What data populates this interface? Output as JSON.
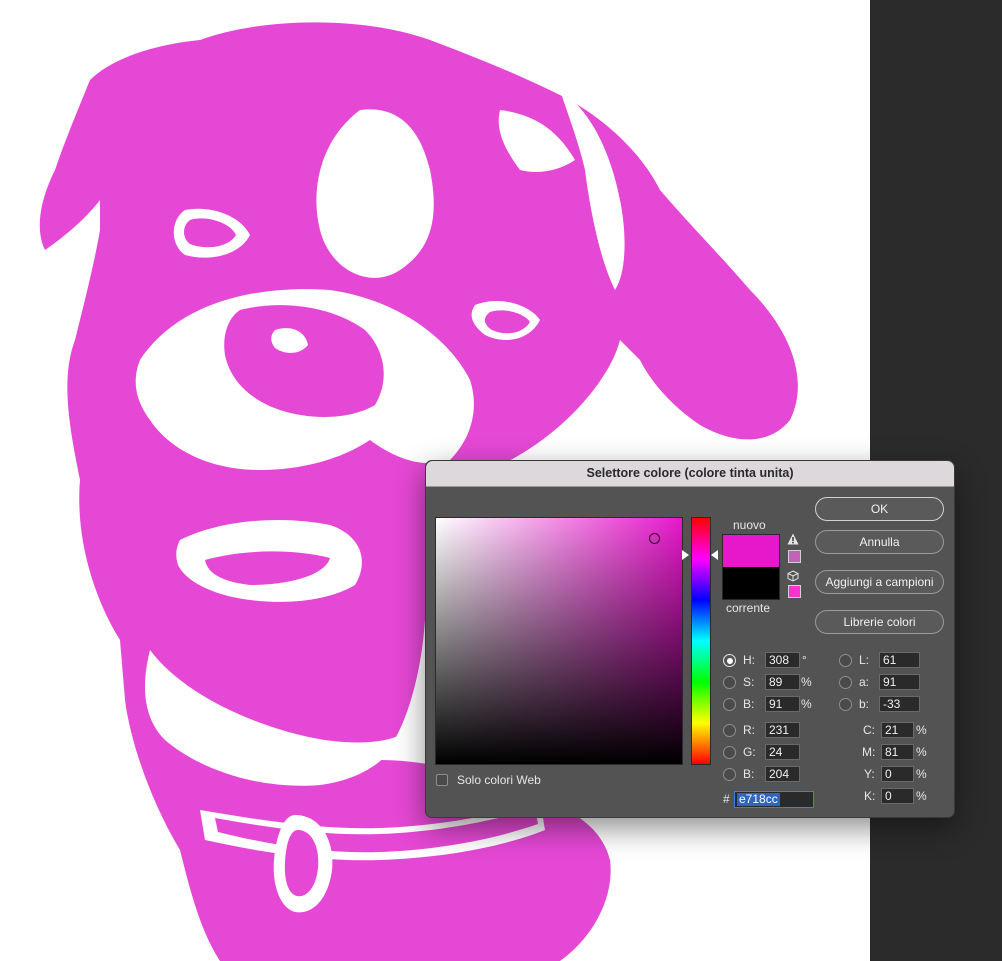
{
  "dialog": {
    "title": "Selettore colore (colore tinta unita)",
    "new_label": "nuovo",
    "current_label": "corrente",
    "new_color": "#e718cc",
    "current_color": "#000000",
    "buttons": {
      "ok": "OK",
      "cancel": "Annulla",
      "add_swatches": "Aggiungi a campioni",
      "libraries": "Librerie colori"
    },
    "web_only_label": "Solo colori Web",
    "web_only_checked": false,
    "hsb": {
      "h_label": "H:",
      "h_value": "308",
      "h_unit": "°",
      "s_label": "S:",
      "s_value": "89",
      "s_unit": "%",
      "b_label": "B:",
      "b_value": "91",
      "b_unit": "%"
    },
    "rgb": {
      "r_label": "R:",
      "r_value": "231",
      "g_label": "G:",
      "g_value": "24",
      "b_label": "B:",
      "b_value": "204"
    },
    "lab": {
      "l_label": "L:",
      "l_value": "61",
      "a_label": "a:",
      "a_value": "91",
      "b_label": "b:",
      "b_value": "-33"
    },
    "cmyk": {
      "c_label": "C:",
      "c_value": "21",
      "c_unit": "%",
      "m_label": "M:",
      "m_value": "81",
      "m_unit": "%",
      "y_label": "Y:",
      "y_value": "0",
      "y_unit": "%",
      "k_label": "K:",
      "k_value": "0",
      "k_unit": "%"
    },
    "hex_prefix": "#",
    "hex_value": "e718cc",
    "selected_mode": "H"
  },
  "canvas": {
    "artwork": "boxer-dog-portrait",
    "fill_color": "#e448d4"
  }
}
